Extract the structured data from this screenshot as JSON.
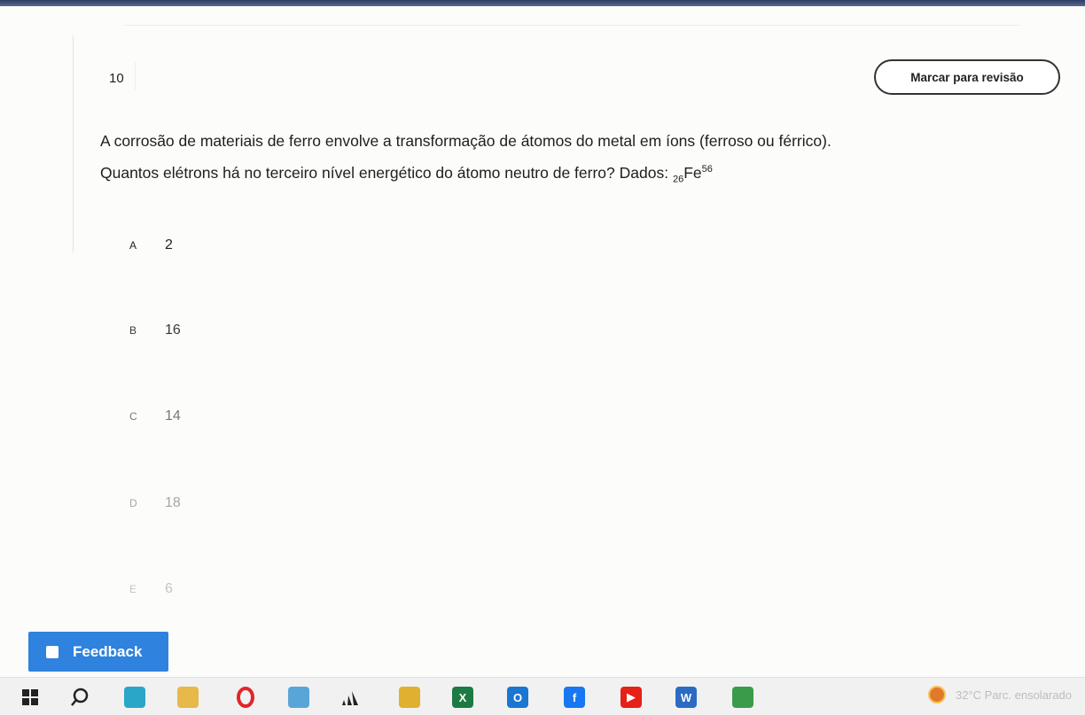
{
  "question": {
    "number": "10",
    "review_label": "Marcar para revisão",
    "line1": "A corrosão de materiais de ferro envolve a transformação de átomos do metal em íons (ferroso ou férrico).",
    "line2": "Quantos elétrons há no terceiro nível energético do átomo neutro de ferro? Dados:",
    "atomic_number": "26",
    "element": "Fe",
    "mass_number": "56"
  },
  "options": [
    {
      "letter": "A",
      "value": "2",
      "color": "#222222"
    },
    {
      "letter": "B",
      "value": "16",
      "color": "#3a3a3a"
    },
    {
      "letter": "C",
      "value": "14",
      "color": "#777777"
    },
    {
      "letter": "D",
      "value": "18",
      "color": "#a6a6a6"
    },
    {
      "letter": "E",
      "value": "6",
      "color": "#c4c4c4"
    }
  ],
  "feedback": {
    "label": "Feedback"
  },
  "taskbar": {
    "icons": [
      {
        "name": "windows-start-icon",
        "glyph": "",
        "bg": "transparent"
      },
      {
        "name": "search-icon",
        "glyph": "",
        "bg": "transparent"
      },
      {
        "name": "edge-browser-icon",
        "glyph": "",
        "bg": "#2aa6c8"
      },
      {
        "name": "file-explorer-icon",
        "glyph": "",
        "bg": "#e7b84a"
      },
      {
        "name": "opera-browser-icon",
        "glyph": "",
        "bg": "transparent"
      },
      {
        "name": "app-blue-icon",
        "glyph": "",
        "bg": "#5aa5d8"
      },
      {
        "name": "adidas-app-icon",
        "glyph": "",
        "bg": "transparent"
      },
      {
        "name": "chrome-icon",
        "glyph": "",
        "bg": "#e0b030"
      },
      {
        "name": "excel-icon",
        "glyph": "X",
        "bg": "#1d7a45"
      },
      {
        "name": "outlook-icon",
        "glyph": "O",
        "bg": "#1a76d1"
      },
      {
        "name": "facebook-icon",
        "glyph": "f",
        "bg": "#1877f2"
      },
      {
        "name": "youtube-icon",
        "glyph": "▶",
        "bg": "#e62117"
      },
      {
        "name": "word-icon",
        "glyph": "W",
        "bg": "#2b6bc3"
      },
      {
        "name": "chrome-profile-icon",
        "glyph": "",
        "bg": "#3a9c4a"
      }
    ],
    "tray_text": "32°C Parc. ensolarado"
  }
}
